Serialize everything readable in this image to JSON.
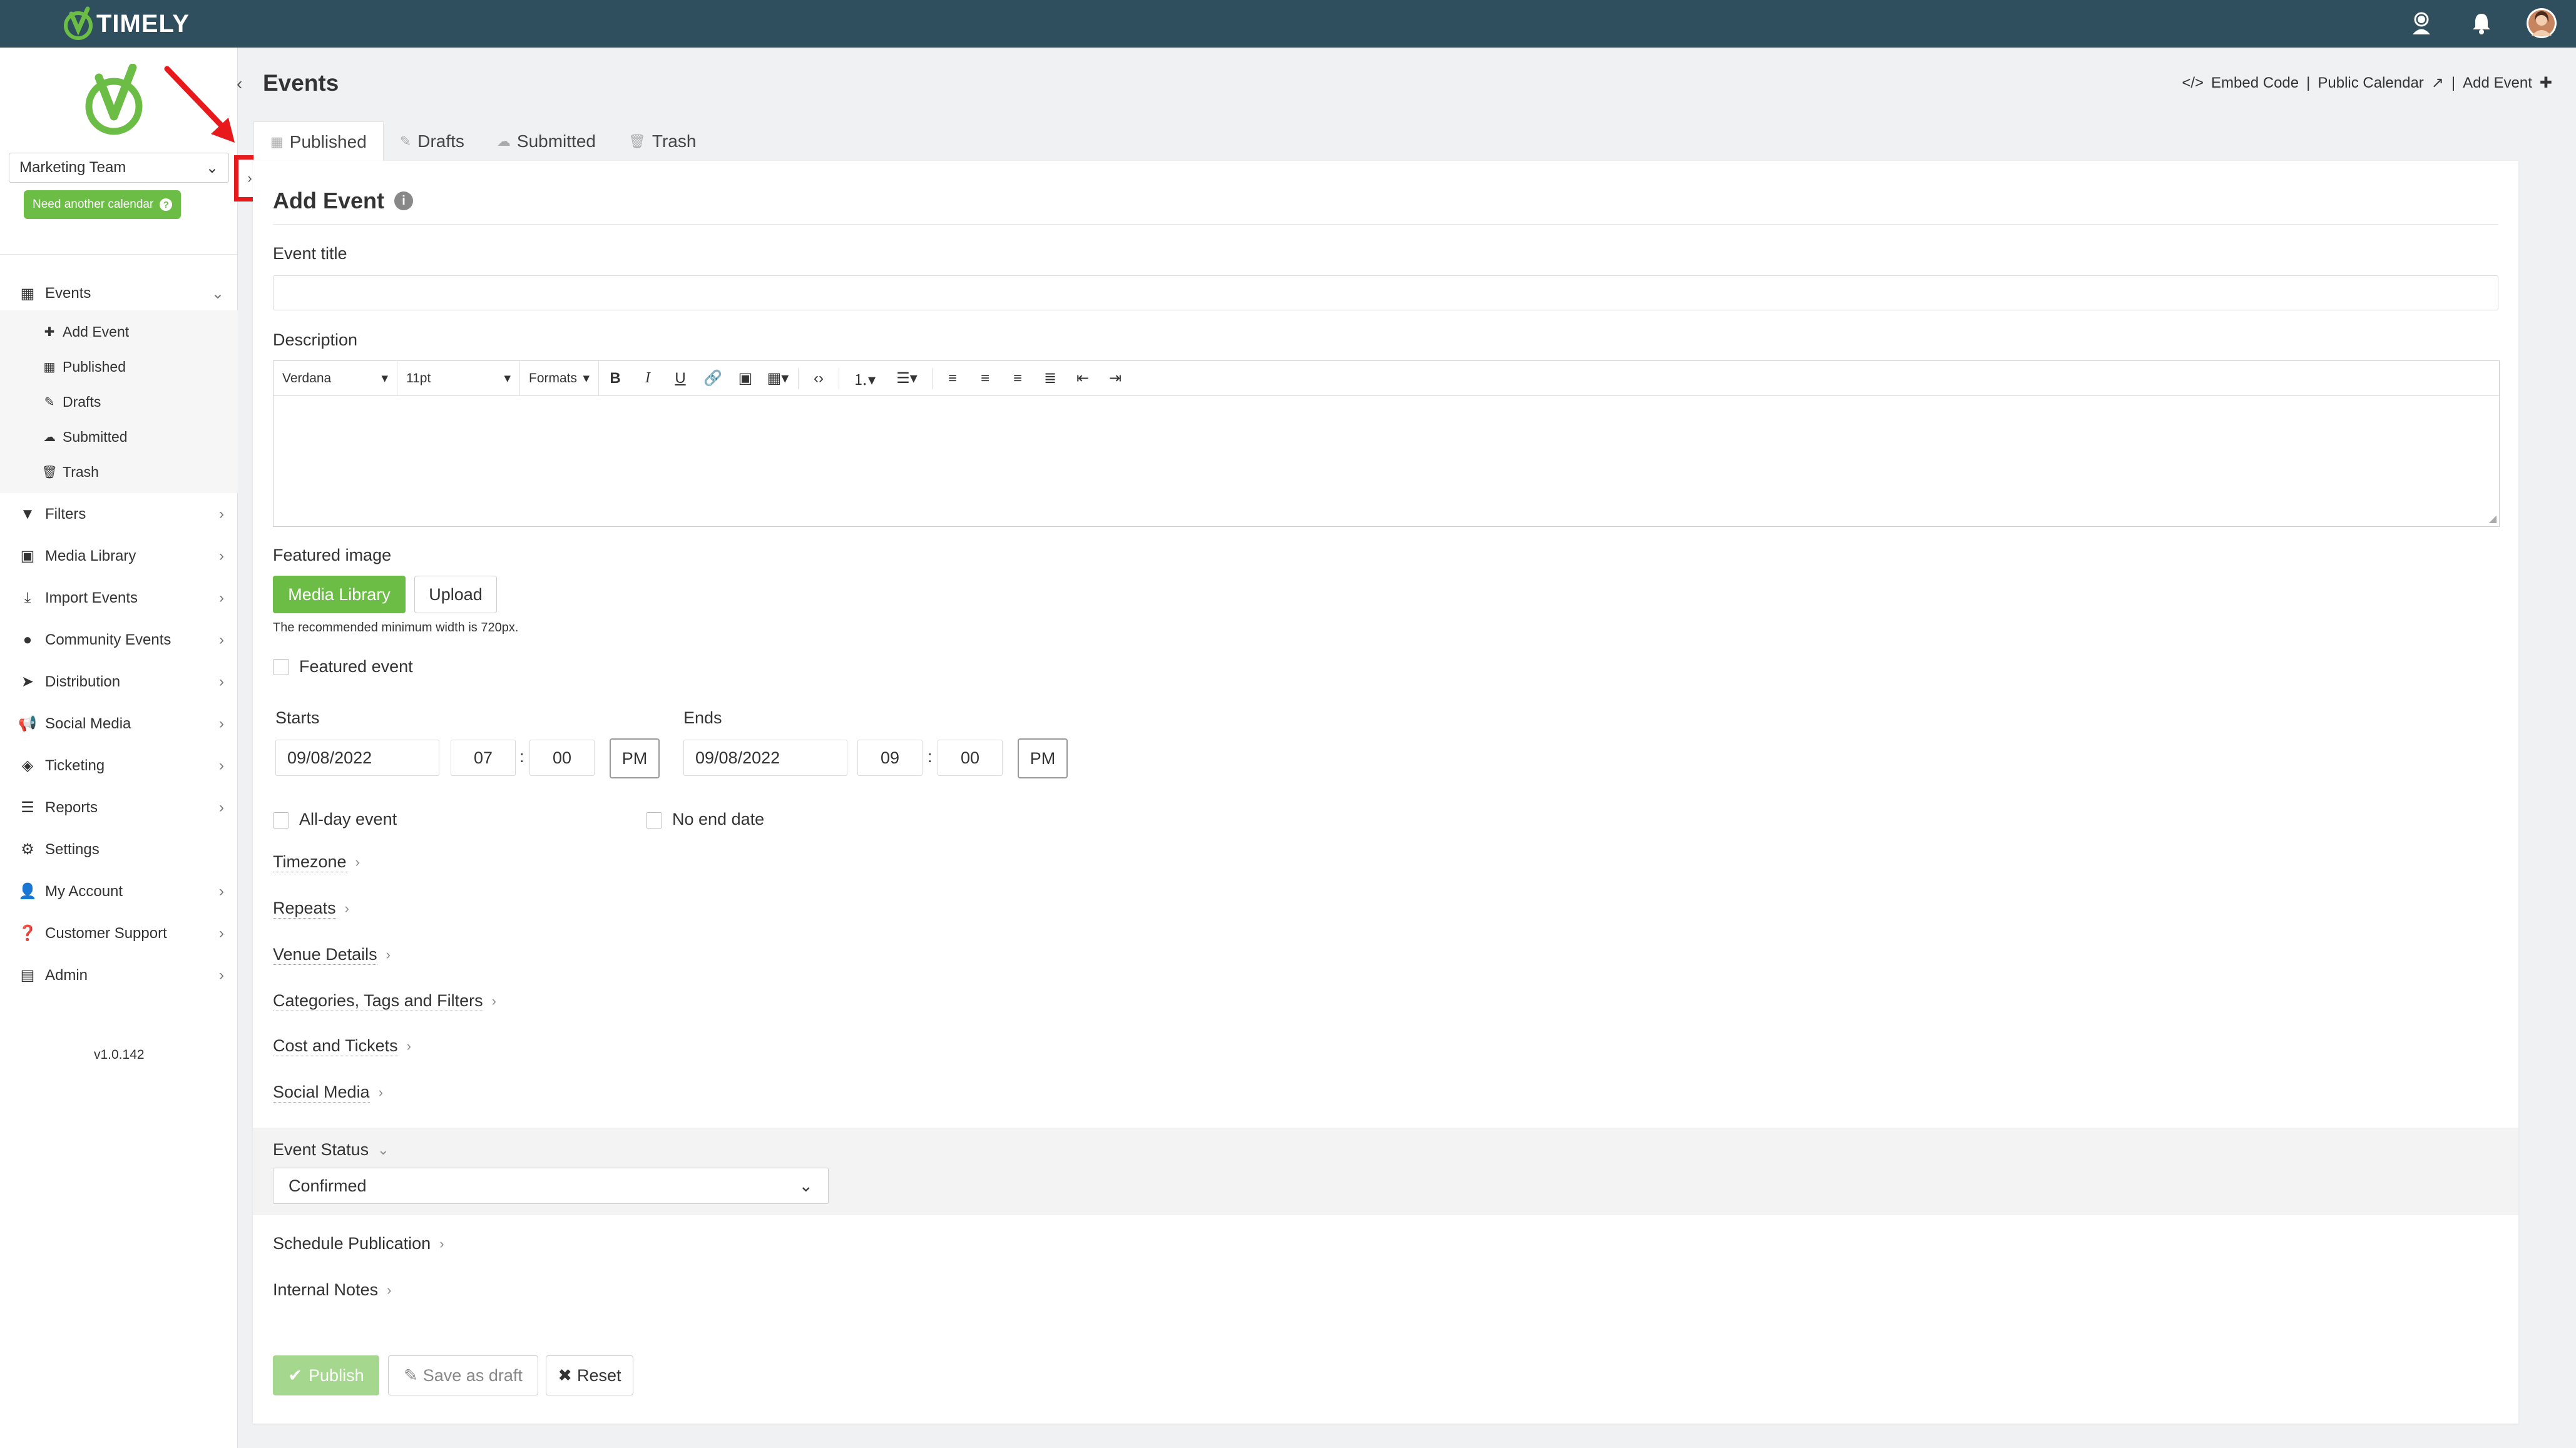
{
  "brand": {
    "name": "TIMELY"
  },
  "colors": {
    "topbar": "#2f4f5f",
    "accent": "#6cbd45",
    "highlight": "#e8191b"
  },
  "sidebar": {
    "calendar_select": "Marketing Team",
    "need_calendar": "Need another calendar",
    "events_label": "Events",
    "events_sub": [
      {
        "label": "Add Event",
        "icon": "plus-icon"
      },
      {
        "label": "Published",
        "icon": "calendar-icon"
      },
      {
        "label": "Drafts",
        "icon": "edit-icon"
      },
      {
        "label": "Submitted",
        "icon": "cloud-icon"
      },
      {
        "label": "Trash",
        "icon": "trash-icon"
      }
    ],
    "items": [
      {
        "label": "Filters",
        "icon": "filter-icon"
      },
      {
        "label": "Media Library",
        "icon": "image-icon"
      },
      {
        "label": "Import Events",
        "icon": "download-icon"
      },
      {
        "label": "Community Events",
        "icon": "globe-icon"
      },
      {
        "label": "Distribution",
        "icon": "paper-plane-icon"
      },
      {
        "label": "Social Media",
        "icon": "bullhorn-icon"
      },
      {
        "label": "Ticketing",
        "icon": "ticket-icon"
      },
      {
        "label": "Reports",
        "icon": "list-icon"
      },
      {
        "label": "Settings",
        "icon": "cogs-icon"
      },
      {
        "label": "My Account",
        "icon": "user-icon"
      },
      {
        "label": "Customer Support",
        "icon": "question-circle-icon"
      },
      {
        "label": "Admin",
        "icon": "id-badge-icon"
      }
    ],
    "version": "v1.0.142"
  },
  "header": {
    "title": "Events",
    "links": {
      "embed": "Embed Code",
      "public_calendar": "Public Calendar",
      "add_event": "Add Event"
    },
    "sep": "|"
  },
  "tabs": [
    {
      "label": "Published",
      "icon": "calendar-icon"
    },
    {
      "label": "Drafts",
      "icon": "edit-icon"
    },
    {
      "label": "Submitted",
      "icon": "cloud-icon"
    },
    {
      "label": "Trash",
      "icon": "trash-icon"
    }
  ],
  "form": {
    "heading": "Add Event",
    "event_title_label": "Event title",
    "event_title_value": "",
    "description_label": "Description",
    "editor": {
      "font": "Verdana",
      "size": "11pt",
      "formats": "Formats"
    },
    "featured_image_label": "Featured image",
    "media_library_btn": "Media Library",
    "upload_btn": "Upload",
    "image_hint": "The recommended minimum width is 720px.",
    "featured_event": "Featured event",
    "starts_label": "Starts",
    "start_date": "09/08/2022",
    "start_hour": "07",
    "start_min": "00",
    "start_ampm": "PM",
    "ends_label": "Ends",
    "end_date": "09/08/2022",
    "end_hour": "09",
    "end_min": "00",
    "end_ampm": "PM",
    "time_sep": ":",
    "all_day": "All-day event",
    "no_end": "No end date",
    "sections": [
      "Timezone",
      "Repeats",
      "Venue Details",
      "Categories, Tags and Filters",
      "Cost and Tickets",
      "Social Media"
    ],
    "status_label": "Event Status",
    "status_value": "Confirmed",
    "schedule_publication": "Schedule Publication",
    "internal_notes": "Internal Notes",
    "publish_btn": "Publish",
    "save_draft_btn": "Save as draft",
    "reset_btn": "Reset"
  }
}
